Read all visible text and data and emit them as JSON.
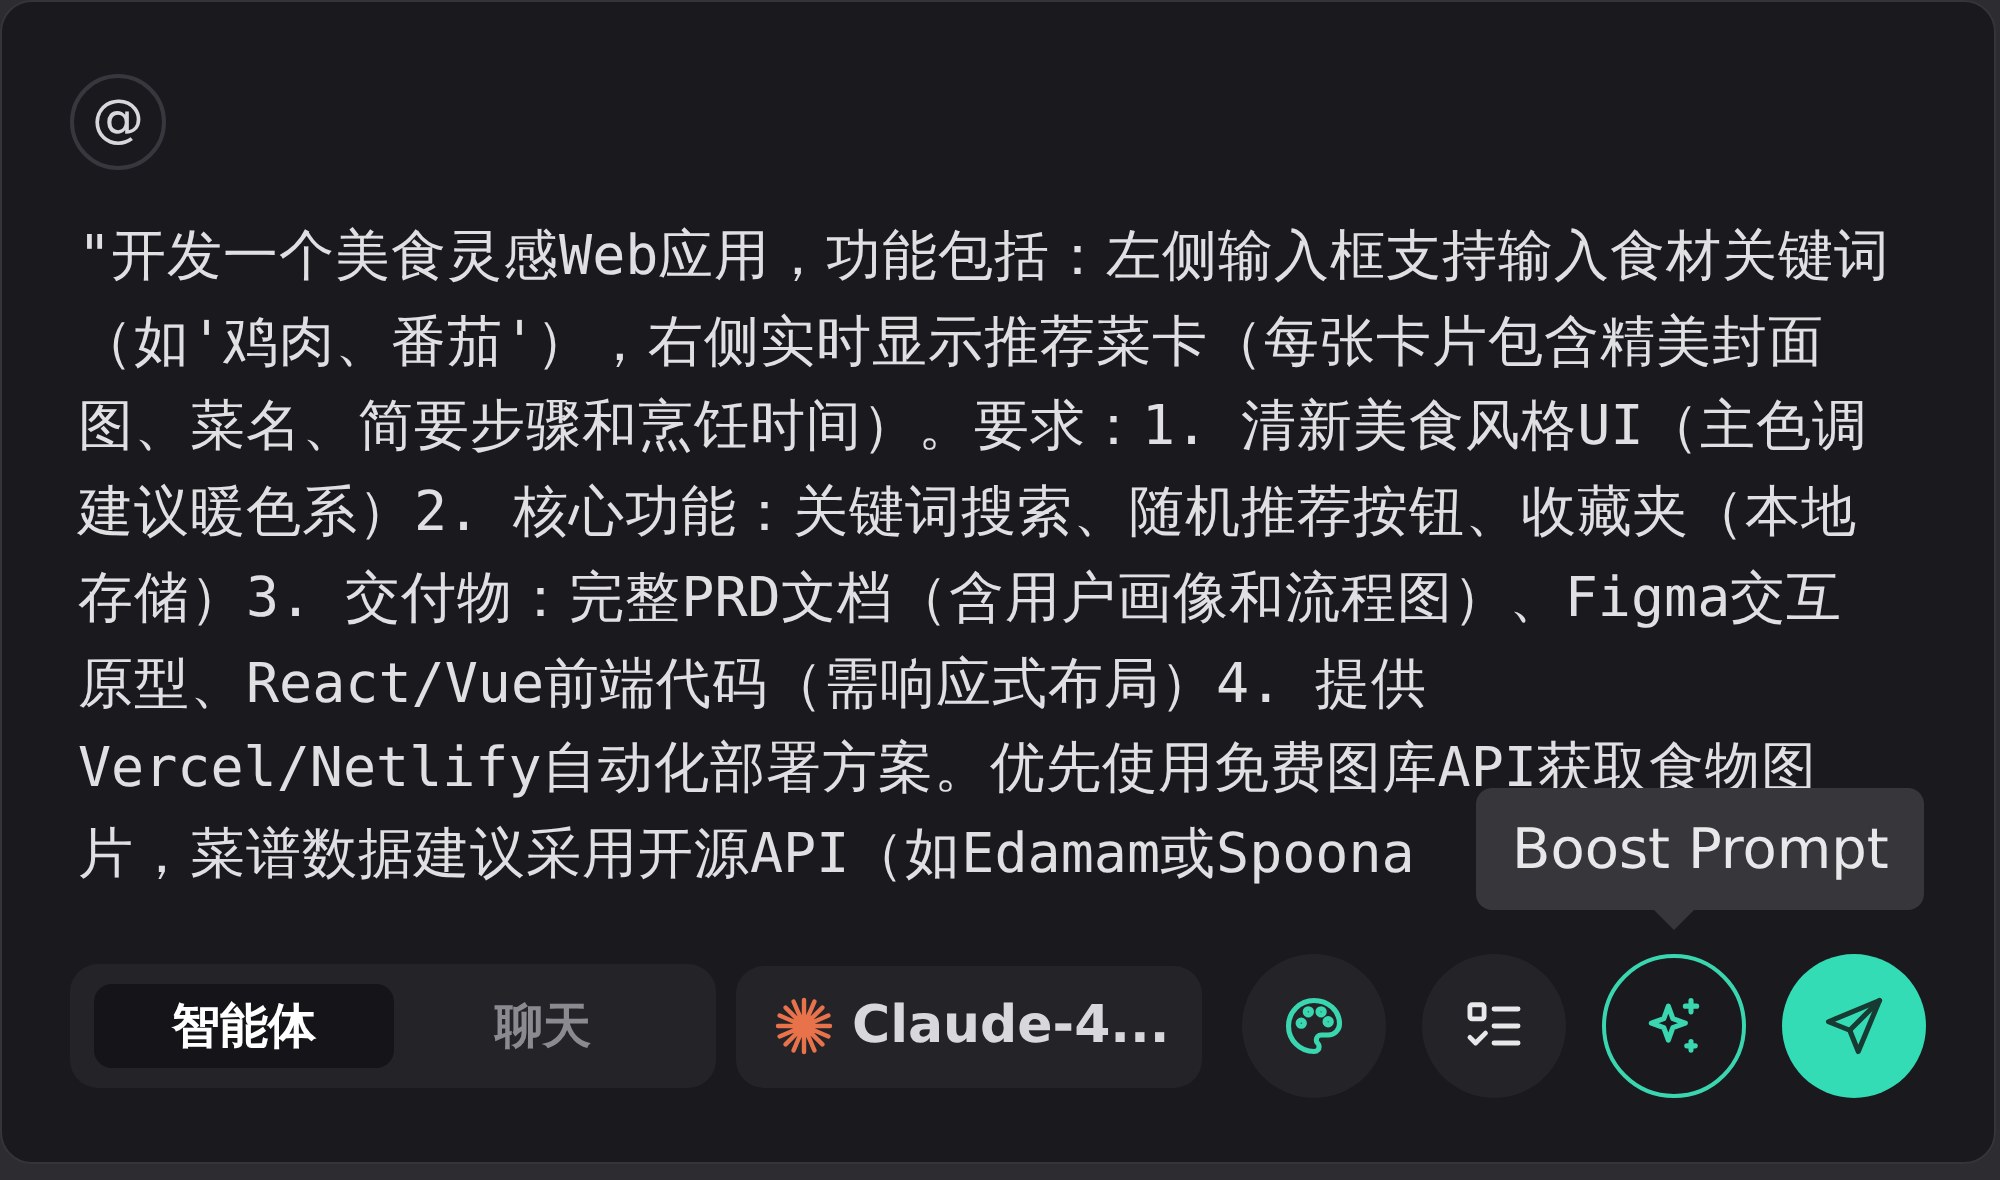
{
  "mention_button": {
    "label": "@"
  },
  "prompt": {
    "lines": [
      "\"开发一个美食灵感Web应用，功能包括：左侧输入框支持输入食材关键词",
      "（如'鸡肉、番茄'），右侧实时显示推荐菜卡（每张卡片包含精美封面",
      "图、菜名、简要步骤和烹饪时间）。要求：1. 清新美食风格UI（主色调",
      "建议暖色系）2. 核心功能：关键词搜索、随机推荐按钮、收藏夹（本地",
      "存储）3. 交付物：完整PRD文档（含用户画像和流程图）、Figma交互",
      "原型、React/Vue前端代码（需响应式布局）4. 提供",
      "Vercel/Netlify自动化部署方案。优先使用免费图库API获取食物图",
      "片，菜谱数据建议采用开源API（如Edamam或Spoona"
    ]
  },
  "mode_tabs": [
    {
      "label": "智能体",
      "selected": true
    },
    {
      "label": "聊天",
      "selected": false
    }
  ],
  "model": {
    "label": "Claude-4..."
  },
  "actions": [
    {
      "kind": "palette",
      "hovered": false
    },
    {
      "kind": "checklist",
      "hovered": false
    },
    {
      "kind": "sparkle",
      "hovered": true,
      "tooltip": "Boost Prompt"
    },
    {
      "kind": "send",
      "hovered": false
    }
  ]
}
